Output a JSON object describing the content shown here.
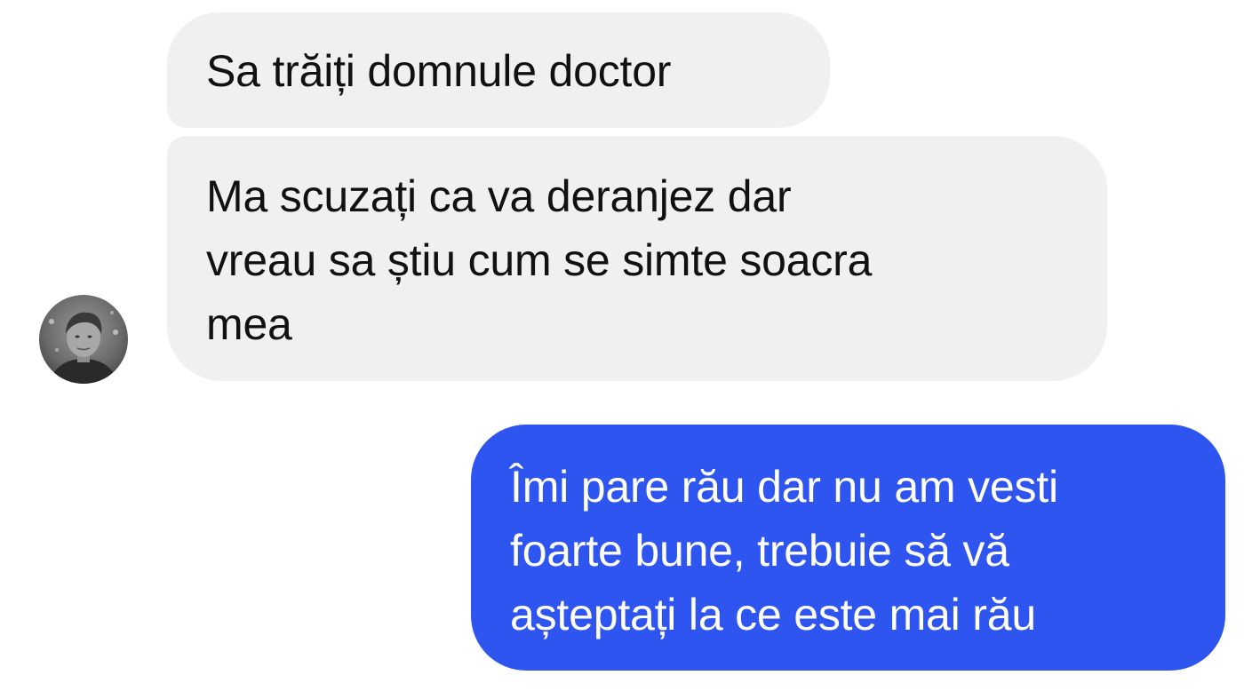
{
  "conversation": {
    "messages": [
      {
        "direction": "incoming",
        "lines": [
          "Sa trăiți domnule doctor"
        ]
      },
      {
        "direction": "incoming",
        "lines": [
          "Ma scuzați ca va deranjez dar",
          "vreau sa știu cum se simte soacra",
          "mea"
        ]
      },
      {
        "direction": "outgoing",
        "lines": [
          "Îmi pare rău dar nu am vesti",
          "foarte bune, trebuie să vă",
          "așteptați la ce este mai rău"
        ]
      }
    ],
    "contact_avatar": {
      "icon": "profile-photo"
    }
  },
  "colors": {
    "incoming_bubble": "#f1f0f0",
    "incoming_text": "#111111",
    "outgoing_bubble": "#2f55f0",
    "outgoing_text": "#ffffff",
    "background": "#ffffff"
  }
}
